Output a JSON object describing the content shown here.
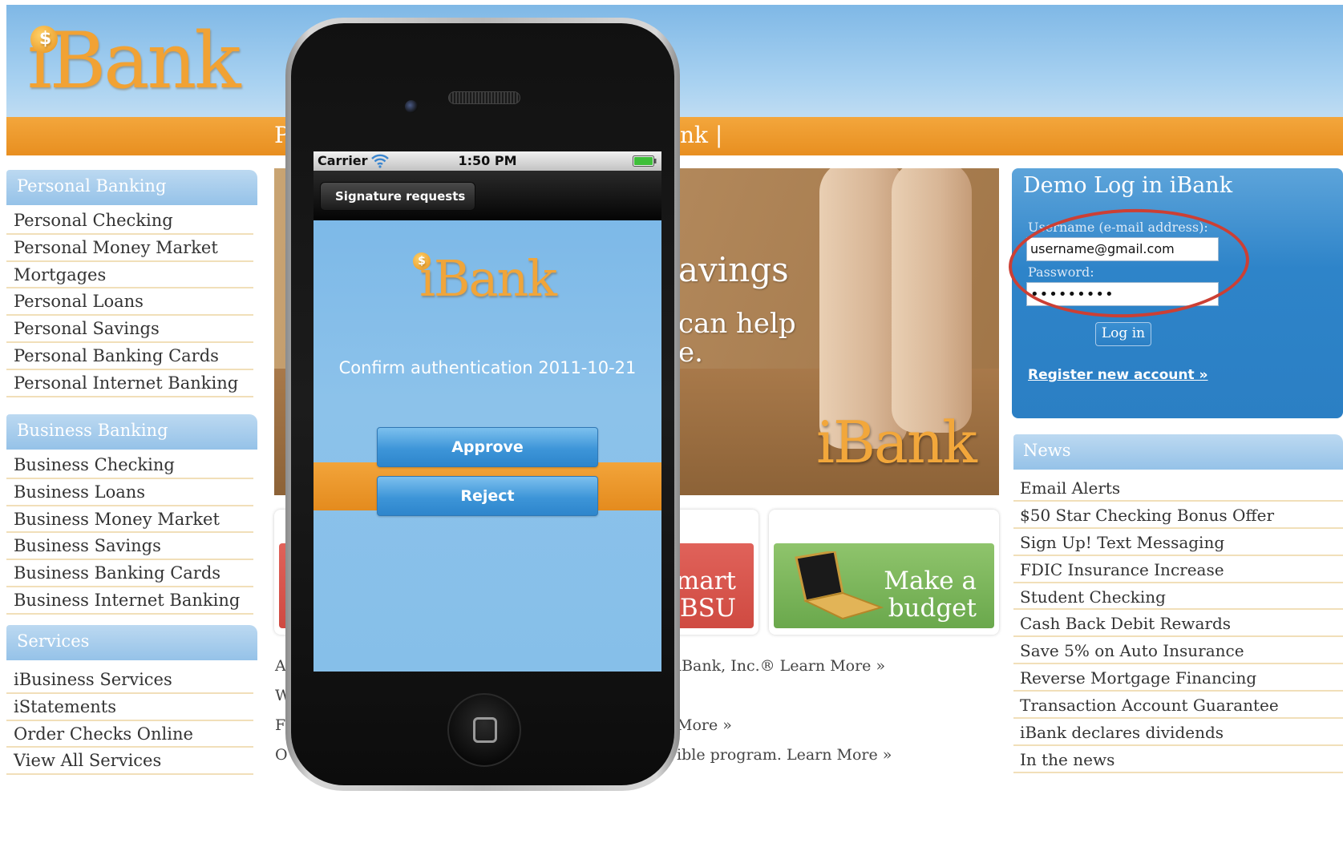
{
  "site": {
    "logo": "iBank",
    "logo_coin": "$",
    "nav_fragment_left": "P",
    "nav_fragment_right": "nk |",
    "personal_banking": {
      "heading": "Personal Banking",
      "items": [
        "Personal Checking",
        "Personal Money Market",
        "Mortgages",
        "Personal Loans",
        "Personal Savings",
        "Personal Banking Cards",
        "Personal Internet Banking"
      ]
    },
    "business_banking": {
      "heading": "Business Banking",
      "items": [
        "Business Checking",
        "Business Loans",
        "Business Money Market",
        "Business Savings",
        "Business Banking Cards",
        "Business Internet Banking"
      ]
    },
    "services": {
      "heading": "Services",
      "items": [
        "iBusiness Services",
        "iStatements",
        "Order Checks Online",
        "View All Services"
      ]
    },
    "hero": {
      "line1": "avings",
      "line2": "can help",
      "line3": "e.",
      "logo": "iBank"
    },
    "promo_red": {
      "line1": "mart",
      "line2": "BSU"
    },
    "promo_green": {
      "line1": "Make a",
      "line2": "budget"
    },
    "center_texts": {
      "t1": "iBank, Inc.®  Learn More »",
      "t2": "More »",
      "t3": "ible program. Learn More »",
      "frag_a": "A",
      "frag_w": "W",
      "frag_f": "F",
      "frag_o": "O"
    },
    "login": {
      "title": "Demo Log in iBank",
      "username_label": "Username (e-mail address):",
      "username_value": "username@gmail.com",
      "password_label": "Password:",
      "password_value": "•••••••••",
      "login_button": "Log in",
      "register_link": "Register new account »",
      "highlight_color": "#cc3f34"
    },
    "news": {
      "heading": "News",
      "items": [
        "Email Alerts",
        "$50 Star Checking Bonus Offer",
        "Sign Up! Text Messaging",
        "FDIC Insurance Increase",
        "Student Checking",
        "Cash Back Debit Rewards",
        "Save 5% on Auto Insurance",
        "Reverse Mortgage Financing",
        "Transaction Account Guarantee",
        "iBank declares dividends",
        "In the news"
      ]
    }
  },
  "phone": {
    "status": {
      "carrier": "Carrier",
      "time": "1:50 PM",
      "wifi_icon": "wifi-icon",
      "battery_icon": "battery-icon"
    },
    "navbar": {
      "back_label": "Signature requests"
    },
    "app": {
      "logo": "iBank",
      "logo_coin": "$",
      "confirm_text": "Confirm authentication 2011-10-21",
      "approve_label": "Approve",
      "reject_label": "Reject"
    }
  },
  "colors": {
    "brand_orange": "#f1a234",
    "header_blue": "#7fb8e6",
    "login_blue": "#2b7fc4",
    "promo_red": "#d9534a",
    "promo_green": "#7cb65a"
  }
}
